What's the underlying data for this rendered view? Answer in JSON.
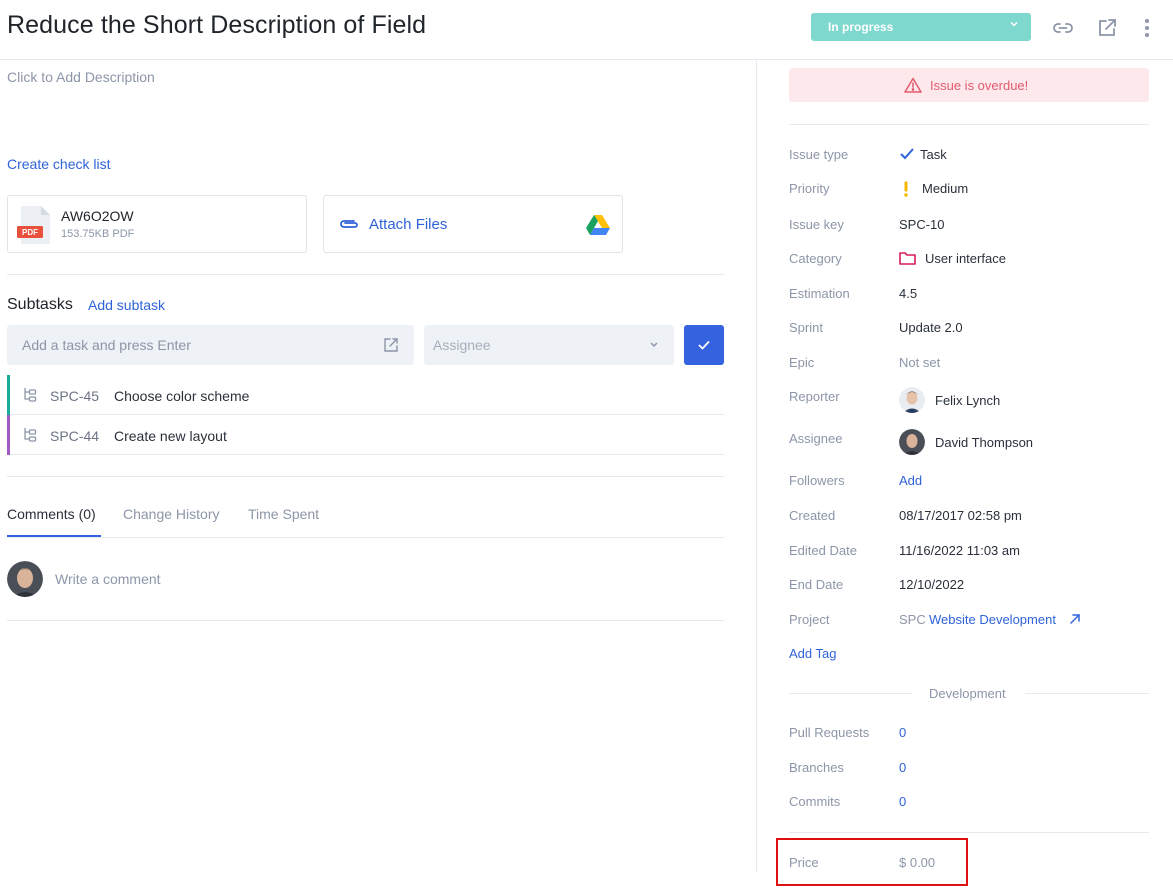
{
  "header": {
    "title": "Reduce the Short Description of Field",
    "status": "In progress",
    "colors": {
      "status_bg": "#7fd8ce",
      "accent": "#3563e0",
      "link": "#2f63d8"
    },
    "icons": [
      "link-icon",
      "open-external-icon",
      "more-vertical-icon"
    ]
  },
  "main": {
    "description_placeholder": "Click to Add Description",
    "create_checklist": "Create check list",
    "attachment": {
      "name": "AW6O2OW",
      "meta": "153.75KB PDF",
      "type_badge": "PDF"
    },
    "attach_files": "Attach Files",
    "subtasks": {
      "title": "Subtasks",
      "add_label": "Add subtask",
      "input_placeholder": "Add a task and press Enter",
      "assignee_placeholder": "Assignee",
      "items": [
        {
          "key": "SPC-45",
          "name": "Choose color scheme",
          "color": "#1aab9b"
        },
        {
          "key": "SPC-44",
          "name": "Create new layout",
          "color": "#a259c4"
        }
      ]
    },
    "tabs": [
      {
        "label": "Comments (0)",
        "active": true
      },
      {
        "label": "Change History",
        "active": false
      },
      {
        "label": "Time Spent",
        "active": false
      }
    ],
    "comment_placeholder": "Write a comment"
  },
  "sidebar": {
    "overdue": "Issue is overdue!",
    "props": {
      "issue_type": {
        "label": "Issue type",
        "value": "Task"
      },
      "priority": {
        "label": "Priority",
        "value": "Medium"
      },
      "issue_key": {
        "label": "Issue key",
        "value": "SPC-10"
      },
      "category": {
        "label": "Category",
        "value": "User interface"
      },
      "estimation": {
        "label": "Estimation",
        "value": "4.5"
      },
      "sprint": {
        "label": "Sprint",
        "value": "Update 2.0"
      },
      "epic": {
        "label": "Epic",
        "value": "Not set"
      },
      "reporter": {
        "label": "Reporter",
        "value": "Felix Lynch"
      },
      "assignee": {
        "label": "Assignee",
        "value": "David Thompson"
      },
      "followers": {
        "label": "Followers",
        "value": "Add"
      },
      "created": {
        "label": "Created",
        "value": "08/17/2017 02:58 pm"
      },
      "edited": {
        "label": "Edited Date",
        "value": "11/16/2022 11:03 am"
      },
      "end": {
        "label": "End Date",
        "value": "12/10/2022"
      },
      "project": {
        "label": "Project",
        "prefix": "SPC",
        "value": "Website Development"
      }
    },
    "add_tag": "Add Tag",
    "development": {
      "title": "Development",
      "pull_requests": {
        "label": "Pull Requests",
        "value": "0"
      },
      "branches": {
        "label": "Branches",
        "value": "0"
      },
      "commits": {
        "label": "Commits",
        "value": "0"
      }
    },
    "price": {
      "label": "Price",
      "value": "$ 0.00"
    }
  }
}
